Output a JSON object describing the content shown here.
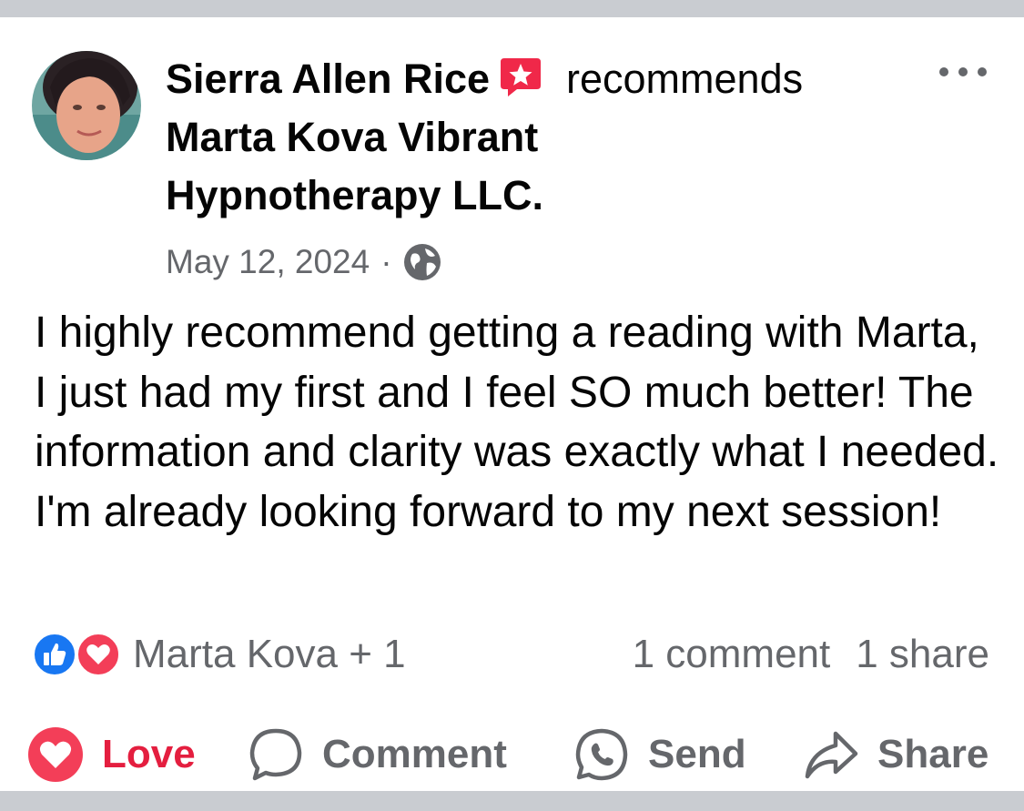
{
  "post": {
    "author": "Sierra Allen Rice",
    "verb": "recommends",
    "page_name_line1": "Marta Kova Vibrant",
    "page_name_line2": "Hypnotherapy LLC.",
    "date": "May 12, 2024",
    "separator": "·",
    "privacy_icon": "globe-icon",
    "text": "I highly recommend getting a reading with Marta, I just had my first and I feel SO much better! The information and clarity was exactly what I needed. I'm already looking forward to my next session!"
  },
  "reactions": {
    "icons": [
      "like-icon",
      "love-icon"
    ],
    "names": "Marta Kova + 1",
    "comments": "1 comment",
    "shares": "1 share"
  },
  "actions": {
    "love_label": "Love",
    "comment_label": "Comment",
    "send_label": "Send",
    "share_label": "Share"
  },
  "colors": {
    "love_red": "#e41e3f",
    "like_blue": "#1877f2",
    "badge_red": "#f02849",
    "secondary_text": "#65676b",
    "frame_gray": "#c9ccd1"
  }
}
